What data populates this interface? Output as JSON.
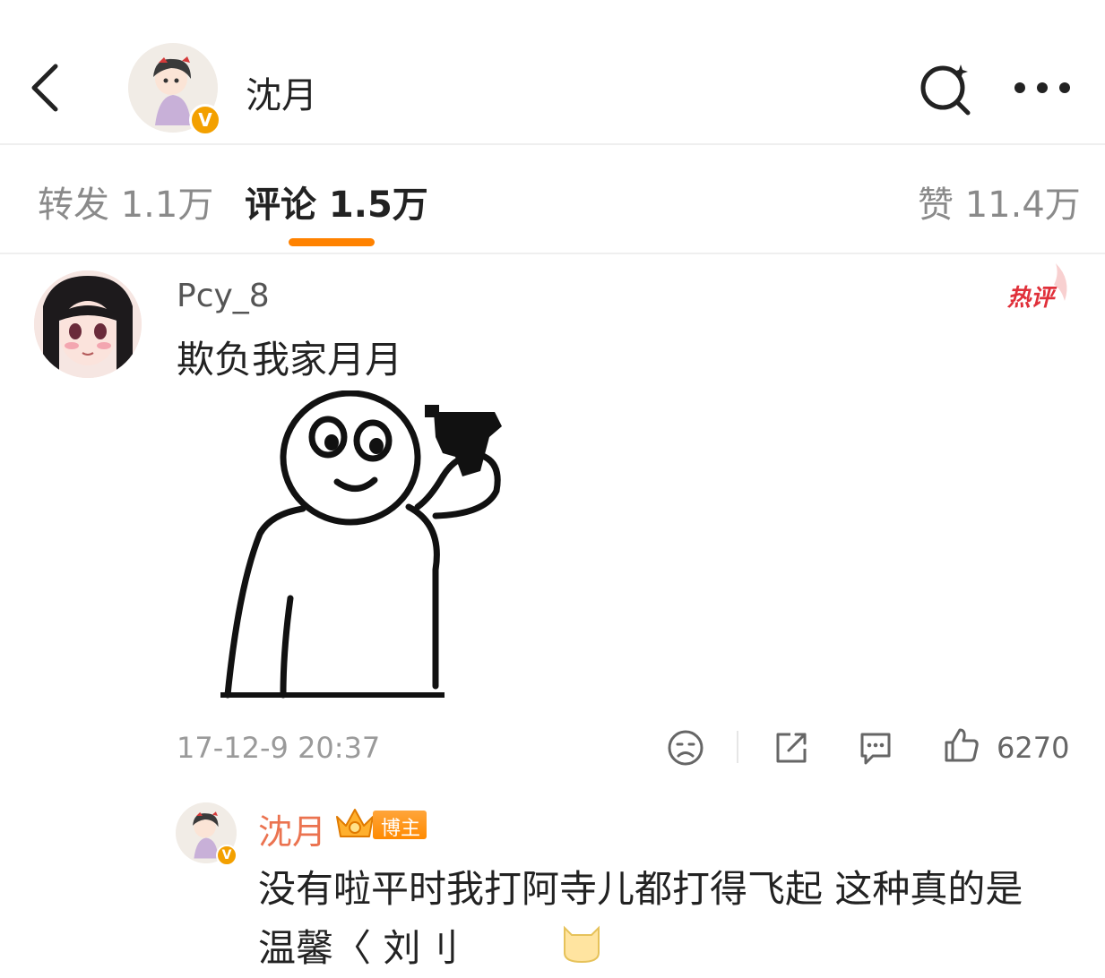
{
  "header": {
    "title": "沈月",
    "verified_badge": "V"
  },
  "tabs": {
    "repost": "转发 1.1万",
    "comments": "评论 1.5万",
    "likes": "赞 11.4万"
  },
  "comment": {
    "username": "Pcy_8",
    "text": "欺负我家月月",
    "hot_badge": "热评",
    "timestamp": "17-12-9 20:37",
    "like_count": "6270"
  },
  "reply": {
    "username": "沈月",
    "author_badge": "博主",
    "verified_badge": "V",
    "text": "没有啦平时我打阿寺儿都打得飞起 这种真的是温馨〈 刘刂"
  },
  "icons": {
    "back": "chevron-left-icon",
    "search": "search-sparkle-icon",
    "more": "more-dots-icon",
    "dislike": "frown-face-icon",
    "share": "share-icon",
    "reply": "chat-bubble-icon",
    "like": "thumbs-up-icon",
    "emoji": "emoji-icon"
  },
  "colors": {
    "accent": "#ff8200",
    "reply_username": "#eb7350",
    "hot_badge": "#e0303a",
    "verified": "#f3a000"
  }
}
